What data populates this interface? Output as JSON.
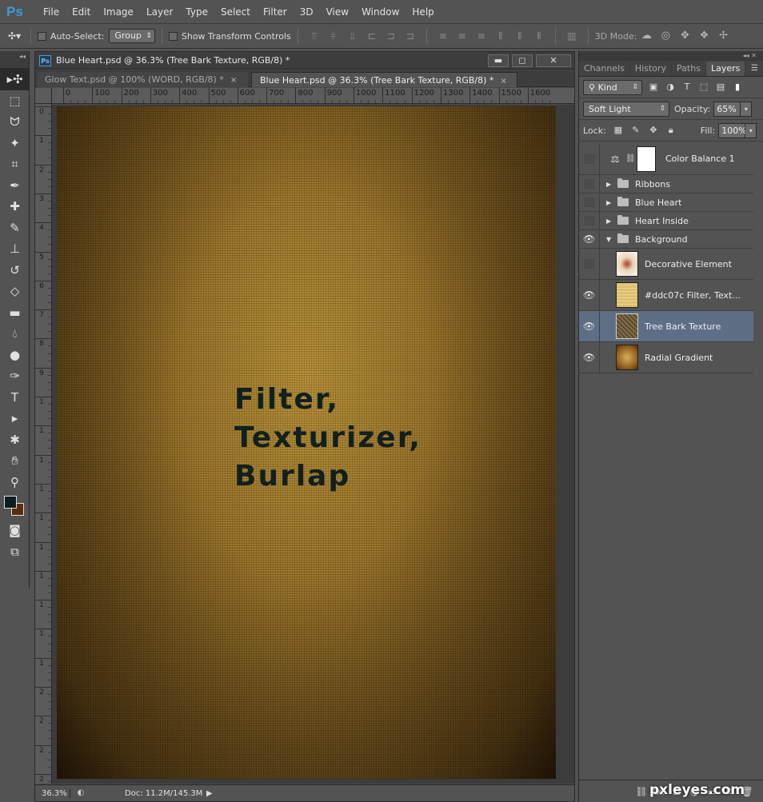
{
  "app": {
    "logo": "Ps"
  },
  "menu": [
    "File",
    "Edit",
    "Image",
    "Layer",
    "Type",
    "Select",
    "Filter",
    "3D",
    "View",
    "Window",
    "Help"
  ],
  "options": {
    "auto_select_label": "Auto-Select:",
    "auto_select_value": "Group",
    "show_transform_label": "Show Transform Controls",
    "mode_3d_label": "3D Mode:"
  },
  "tools": [
    "move-tool",
    "marquee-tool",
    "lasso-tool",
    "quick-select-tool",
    "crop-tool",
    "eyedropper-tool",
    "healing-brush-tool",
    "brush-tool",
    "clone-stamp-tool",
    "history-brush-tool",
    "eraser-tool",
    "gradient-tool",
    "blur-tool",
    "dodge-tool",
    "pen-tool",
    "type-tool",
    "path-select-tool",
    "shape-tool",
    "hand-tool",
    "zoom-tool"
  ],
  "colors": {
    "foreground": "#0b1d1f",
    "background": "#5a2d0e",
    "selected_layer": "#5d6e85"
  },
  "document": {
    "title": "Blue Heart.psd @ 36.3% (Tree Bark Texture, RGB/8) *",
    "tabs": [
      {
        "label": "Glow Text.psd @ 100% (WORD, RGB/8) *",
        "close": "×"
      },
      {
        "label": "Blue Heart.psd @ 36.3% (Tree Bark Texture, RGB/8) *",
        "close": "×"
      }
    ],
    "ruler_h": [
      "0",
      "100",
      "200",
      "300",
      "400",
      "500",
      "600",
      "700",
      "800",
      "900",
      "1000",
      "1100",
      "1200",
      "1300",
      "1400",
      "1500",
      "1600"
    ],
    "ruler_v": [
      "0",
      "1",
      "2",
      "3",
      "4",
      "5",
      "6",
      "7",
      "8",
      "9",
      "1",
      "1",
      "1",
      "1",
      "1",
      "1",
      "1",
      "1",
      "1",
      "1",
      "2",
      "2",
      "2",
      "2"
    ],
    "canvas_text": [
      "Filter,",
      "Texturizer,",
      "Burlap"
    ],
    "zoom": "36.3%",
    "doc_size": "Doc: 11.2M/145.3M"
  },
  "panel": {
    "tabs": [
      "Channels",
      "History",
      "Paths",
      "Layers"
    ],
    "filter_kind": "Kind",
    "blend_mode": "Soft Light",
    "opacity_label": "Opacity:",
    "opacity_value": "65%",
    "lock_label": "Lock:",
    "fill_label": "Fill:",
    "fill_value": "100%",
    "layers": [
      {
        "name": "Color Balance 1",
        "type": "adjustment",
        "visible": false
      },
      {
        "name": "Ribbons",
        "type": "group",
        "visible": false,
        "expanded": false
      },
      {
        "name": "Blue Heart",
        "type": "group",
        "visible": false,
        "expanded": false
      },
      {
        "name": "Heart Inside",
        "type": "group",
        "visible": false,
        "expanded": false
      },
      {
        "name": "Background",
        "type": "group",
        "visible": true,
        "expanded": true
      },
      {
        "name": "Decorative Element",
        "type": "layer",
        "visible": false,
        "thumb": "deco"
      },
      {
        "name": "#ddc07c  Filter, Text...",
        "type": "layer",
        "visible": true,
        "thumb": "filter"
      },
      {
        "name": "Tree Bark Texture",
        "type": "layer",
        "visible": true,
        "thumb": "bark",
        "selected": true
      },
      {
        "name": "Radial Gradient",
        "type": "layer",
        "visible": true,
        "thumb": "radial"
      }
    ]
  },
  "watermark": "pxleyes.com"
}
